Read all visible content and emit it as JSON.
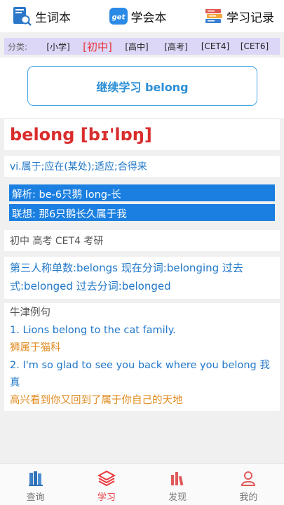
{
  "header": {
    "vocab_label": "生词本",
    "learned_label": "学会本",
    "learned_icon_text": "get",
    "history_label": "学习记录"
  },
  "category": {
    "label": "分类:",
    "items": [
      "[小学]",
      "[初中]",
      "[高中]",
      "[高考]",
      "[CET4]",
      "[CET6]"
    ],
    "active_index": 1
  },
  "continue_button": "继续学习 belong",
  "word": {
    "headword": "belong [bɪ'lɒŋ]",
    "meaning": "vi.属于;应在(某处);适应;合得来",
    "analysis": "解析: be-6只鹅 long-长",
    "association": "联想: 那6只鹅长久属于我",
    "levels": "初中 高考 CET4 考研",
    "forms_line1": "第三人称单数:belongs 现在分词:belonging 过去",
    "forms_line2": "式:belonged 过去分词:belonged"
  },
  "examples": {
    "title": "牛津例句",
    "ex1_en": "1. Lions belong to the cat family.",
    "ex1_cn": "狮属于猫科",
    "ex2_line1": "2. I'm so glad to see you back where you belong 我真",
    "ex2_line2": "高兴看到你又回到了属于你自己的天地"
  },
  "tabs": [
    {
      "label": "查询",
      "icon": "books-icon"
    },
    {
      "label": "学习",
      "icon": "layers-icon"
    },
    {
      "label": "发现",
      "icon": "bars-icon"
    },
    {
      "label": "我的",
      "icon": "person-icon"
    }
  ],
  "colors": {
    "accent_red": "#e8383d",
    "accent_blue": "#2077c9",
    "highlight_blue": "#1a7fe0",
    "category_bg": "#dcd6f7"
  }
}
